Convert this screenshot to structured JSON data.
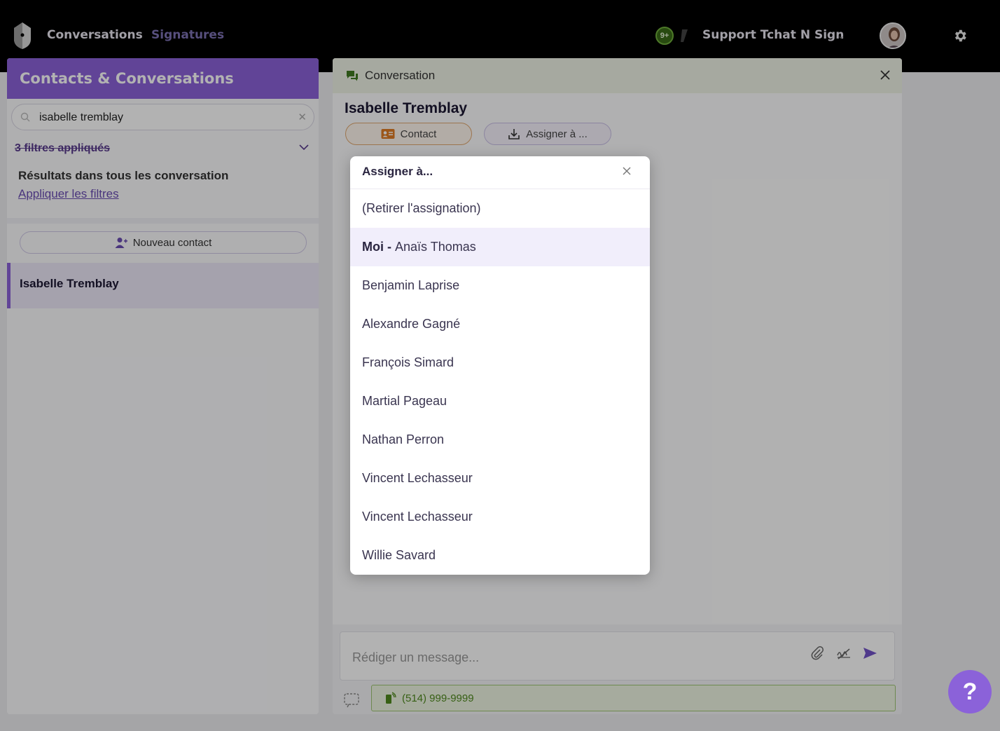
{
  "topbar": {
    "nav": [
      {
        "label": "Conversations"
      },
      {
        "label": "Signatures"
      }
    ],
    "notification_count": "9+",
    "org_name": "Support Tchat N Sign"
  },
  "left_panel": {
    "title": "Contacts & Conversations",
    "search_value": "isabelle tremblay",
    "filters_label": "3 filtres appliqués",
    "results_label": "Résultats dans tous les conversation",
    "apply_filters_label": "Appliquer les filtres",
    "new_contact_label": "Nouveau contact",
    "contacts": [
      {
        "name": "Isabelle Tremblay"
      }
    ]
  },
  "conversation": {
    "header_title": "Conversation",
    "contact_name": "Isabelle Tremblay",
    "contact_button": "Contact",
    "assign_button": "Assigner à ...",
    "message_placeholder": "Rédiger un message...",
    "phone": "(514) 999-9999"
  },
  "assign_modal": {
    "title": "Assigner à...",
    "options": [
      {
        "prefix": "",
        "label": "(Retirer l'assignation)"
      },
      {
        "prefix": "Moi -",
        "label": "Anaïs Thomas"
      },
      {
        "prefix": "",
        "label": "Benjamin Laprise"
      },
      {
        "prefix": "",
        "label": "Alexandre Gagné"
      },
      {
        "prefix": "",
        "label": "François Simard"
      },
      {
        "prefix": "",
        "label": "Martial Pageau"
      },
      {
        "prefix": "",
        "label": "Nathan Perron"
      },
      {
        "prefix": "",
        "label": "Vincent Lechasseur"
      },
      {
        "prefix": "",
        "label": "Vincent Lechasseur"
      },
      {
        "prefix": "",
        "label": "Willie Savard"
      }
    ]
  },
  "help_button_label": "?",
  "colors": {
    "brand_purple": "#8b62d9",
    "topbar": "#000000",
    "success_green": "#4f8a1e"
  },
  "icons": [
    "logo-icon",
    "org-mark-icon",
    "avatar",
    "gear-icon",
    "search-icon",
    "clear-icon",
    "chevron-down-icon",
    "add-user-icon",
    "chat-icon",
    "close-icon",
    "contact-card-icon",
    "download-icon",
    "paperclip-icon",
    "no-signature-icon",
    "send-icon",
    "selection-icon",
    "phone-icon"
  ]
}
